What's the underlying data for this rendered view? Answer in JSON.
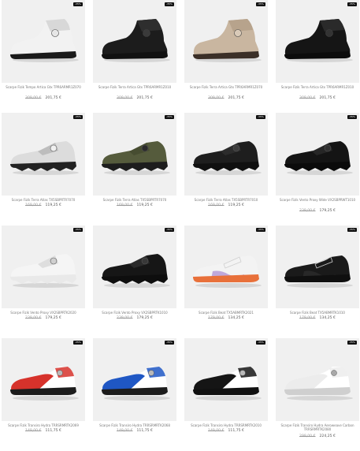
{
  "products": [
    {
      "badge": "-35%",
      "name": "Scarpe Fizik Tempo Artica Gtx TPR6ARMR1Z070",
      "old_price": "309,00 €",
      "new_price": "201,75 €",
      "colors": {
        "upper": "#f2f2f2",
        "accent": "#d8d8d8",
        "sole": "#1a1a1a",
        "dial": "#e6e6e6"
      },
      "style": "boot"
    },
    {
      "badge": "-35%",
      "name": "Scarpe Fizik Terra Artica Gtx TPR6ARMR1Z010",
      "old_price": "309,00 €",
      "new_price": "201,75 €",
      "colors": {
        "upper": "#1c1c1c",
        "accent": "#2e2e2e",
        "sole": "#111111",
        "dial": "#3a3a3a"
      },
      "style": "boot"
    },
    {
      "badge": "-35%",
      "name": "Scarpe Fizik Terra Artica Gtx TPR6ARMR1Z070",
      "old_price": "309,00 €",
      "new_price": "201,75 €",
      "colors": {
        "upper": "#c9b6a0",
        "accent": "#b7a38c",
        "sole": "#3b2f27",
        "dial": "#d9cab8"
      },
      "style": "boot"
    },
    {
      "badge": "-35%",
      "name": "Scarpe Fizik Terra Artica Gtx TPR6ARMR1Z010",
      "old_price": "309,00 €",
      "new_price": "201,75 €",
      "colors": {
        "upper": "#151515",
        "accent": "#2a2a2a",
        "sole": "#0c0c0c",
        "dial": "#333333"
      },
      "style": "boot"
    },
    {
      "badge": "-35%",
      "name": "Scarpe Fizik Terra Atlas TX5SBPRTR7070",
      "old_price": "169,00 €",
      "new_price": "119,25 €",
      "colors": {
        "upper": "#dcdcdc",
        "accent": "#bdbdbd",
        "sole": "#222222",
        "dial": "#f0f0f0"
      },
      "style": "mtb"
    },
    {
      "badge": "-35%",
      "name": "Scarpe Fizik Terra Atlas TX5SBPRTR7070",
      "old_price": "169,00 €",
      "new_price": "119,25 €",
      "colors": {
        "upper": "#555b3c",
        "accent": "#474d31",
        "sole": "#1d1d1d",
        "dial": "#2b2b2b"
      },
      "style": "mtb"
    },
    {
      "badge": "-35%",
      "name": "Scarpe Fizik Terra Atlas TX5SBPRTR7010",
      "old_price": "169,00 €",
      "new_price": "119,25 €",
      "colors": {
        "upper": "#1e1e1e",
        "accent": "#2c2c2c",
        "sole": "#101010",
        "dial": "#3c3c3c"
      },
      "style": "mtb"
    },
    {
      "badge": "-35%",
      "name": "Scarpe Fizik Vento Proxy Wide VX2SBPRWT1010",
      "old_price": "239,00 €",
      "new_price": "179,25 €",
      "colors": {
        "upper": "#141414",
        "accent": "#262626",
        "sole": "#0b0b0b",
        "dial": "#2f2f2f"
      },
      "style": "mtb"
    },
    {
      "badge": "-35%",
      "name": "Scarpe Fizik Vento Proxy VX2SBPRTK2020",
      "old_price": "239,00 €",
      "new_price": "179,25 €",
      "colors": {
        "upper": "#f5f5f5",
        "accent": "#dedede",
        "sole": "#e9e9e9",
        "dial": "#cfcfcf"
      },
      "style": "mtb"
    },
    {
      "badge": "-35%",
      "name": "Scarpe Fizik Vento Proxy VX2SBPRTK1010",
      "old_price": "239,00 €",
      "new_price": "179,25 €",
      "colors": {
        "upper": "#161616",
        "accent": "#2a2a2a",
        "sole": "#0e0e0e",
        "dial": "#383838"
      },
      "style": "mtb"
    },
    {
      "badge": "-35%",
      "name": "Scarpe Fizik Beat TX5ABMRTK2021",
      "old_price": "179,00 €",
      "new_price": "134,25 €",
      "colors": {
        "upper": "#f3f3f3",
        "accent": "#b59ad6",
        "sole": "#e8703a",
        "dial": "#f0f0f0"
      },
      "style": "lace"
    },
    {
      "badge": "-35%",
      "name": "Scarpe Fizik Beat TX5ABMRTK1010",
      "old_price": "179,00 €",
      "new_price": "134,25 €",
      "colors": {
        "upper": "#1a1a1a",
        "accent": "#2b2b2b",
        "sole": "#0f0f0f",
        "dial": "#2b2b2b"
      },
      "style": "lace"
    },
    {
      "badge": "-35%",
      "name": "Scarpe Fizik Transiro Hydra TRRSRMRTK2069",
      "old_price": "149,00 €",
      "new_price": "111,75 €",
      "colors": {
        "upper": "#d6322b",
        "accent": "#ffffff",
        "sole": "#1c1c1c",
        "dial": "#b9b9b9"
      },
      "style": "tri"
    },
    {
      "badge": "-35%",
      "name": "Scarpe Fizik Transiro Hydra TRRSRMRTK2068",
      "old_price": "149,00 €",
      "new_price": "111,75 €",
      "colors": {
        "upper": "#1f57c4",
        "accent": "#ffffff",
        "sole": "#1c1c1c",
        "dial": "#b9b9b9"
      },
      "style": "tri"
    },
    {
      "badge": "-35%",
      "name": "Scarpe Fizik Transiro Hydra TRRSRMRTK2010",
      "old_price": "149,00 €",
      "new_price": "111,75 €",
      "colors": {
        "upper": "#151515",
        "accent": "#ffffff",
        "sole": "#111111",
        "dial": "#b9b9b9"
      },
      "style": "tri"
    },
    {
      "badge": "-35%",
      "name": "Scarpe Fizik Transiro Hydra Aeroweave Carbon TRRSRMRTK2080",
      "old_price": "299,00 €",
      "new_price": "224,25 €",
      "colors": {
        "upper": "#ececec",
        "accent": "#ffffff",
        "sole": "#cfcfcf",
        "dial": "#a8a8a8"
      },
      "style": "tri"
    }
  ]
}
